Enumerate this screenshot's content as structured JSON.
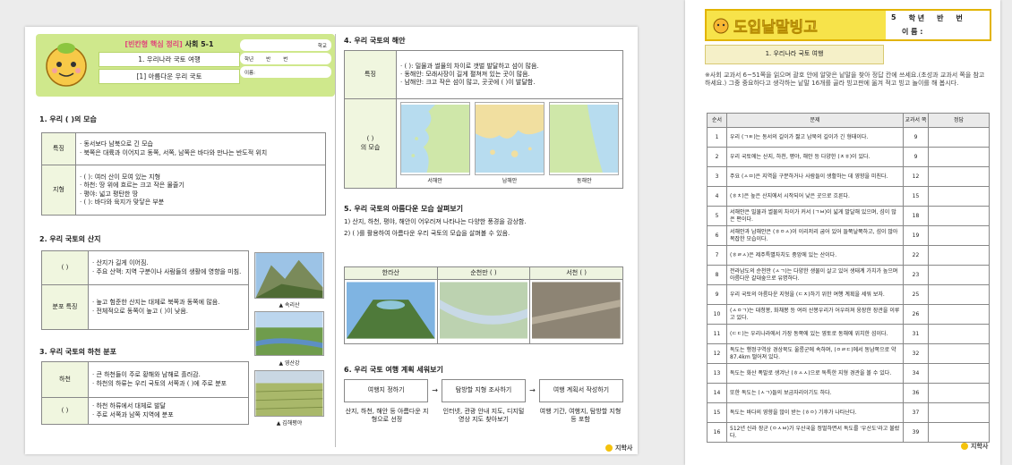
{
  "p1": {
    "header": {
      "badge": "[빈칸형 핵심 정리]",
      "subject": "사회 5-1",
      "unit": "1. 우리나라 국토 여행",
      "lesson": "[1] 아름다운 우리 국토",
      "school": "학교",
      "grade": "학년",
      "class": "반",
      "number": "번",
      "name": "이름:"
    },
    "s1": {
      "title": "1. 우리 (             )의 모습",
      "rows": [
        {
          "label": "특징",
          "lines": [
            "· 동서보다 남북으로 긴 모습",
            "· 북쪽은 대륙과 이어지고 동쪽, 서쪽, 남쪽은 바다와 만나는 반도적 위치"
          ]
        },
        {
          "label": "지형",
          "lines": [
            "· (             ): 여러 산이 모여 있는 지형",
            "· 하천: 땅 위에 흐르는 크고 작은 물줄기",
            "· 평야: 넓고 평탄한 땅",
            "· (             ): 바다와 육지가 맞닿은 부분"
          ]
        }
      ]
    },
    "s2": {
      "title": "2. 우리 국토의 산지",
      "rows": [
        {
          "label": "(           )",
          "lines": [
            "· 산지가 길게 이어짐.",
            "· 주요 산맥: 지역 구분이나 사람들의 생활에 영향을 미침."
          ]
        },
        {
          "label": "분포 특징",
          "lines": [
            "· 높고 험준한 산지는 대체로 북쪽과 동쪽에 많음.",
            "· 전체적으로 동쪽이 높고 (         )이 낮음."
          ]
        }
      ]
    },
    "s3": {
      "title": "3. 우리 국토의 하천 분포",
      "rows": [
        {
          "label": "하천",
          "lines": [
            "· 큰 하천들이 주로 황해와 남해로 흘러감.",
            "· 하천의 하류는 우리 국토의 서쪽과 (           )에 주로 분포"
          ]
        },
        {
          "label": "(           )",
          "lines": [
            "· 하천 하류에서 대체로 발달",
            "· 주로 서쪽과 남쪽 지역에 분포"
          ]
        }
      ]
    },
    "photos": {
      "cap1": "▲ 속리산",
      "cap2": "▲ 영산강",
      "cap3": "▲ 김해평야"
    },
    "s4": {
      "title": "4. 우리 국토의 해안",
      "feat_label": "특징",
      "feat_lines": [
        "· (             ): 밀물과 썰물의 차이로 갯벌 발달하고 섬이 많음.",
        "· 동해안: 모래사장이 길게 펼쳐져 있는 곳이 많음.",
        "· 남해안: 크고 작은 섬이 많고, 곳곳에 (         )이 발달함."
      ],
      "shape_label1": "(           )",
      "shape_label2": "의 모습",
      "maps": [
        "서해안",
        "남해안",
        "동해안"
      ]
    },
    "s5": {
      "title": "5. 우리 국토의 아름다운 모습 살펴보기",
      "line1": "1) 산지, 하천, 평야, 해안이 어우러져 나타나는 다양한 풍경을 감상함.",
      "line2": "2) (                        )를 활용하여 아름다운 우리 국토의 모습을 살펴볼 수 있음.",
      "photos": [
        "한라산",
        "순천만 (          )",
        "서천 (          )"
      ]
    },
    "s6": {
      "title": "6. 우리 국토 여행 계획 세워보기",
      "steps": [
        "여행지 정하기",
        "탐방할 지형 조사하기",
        "여행 계획서 작성하기"
      ],
      "arrow": "→",
      "details": [
        "산지, 하천, 해안 등 아름다운 지형으로 선정",
        "인터넷, 관광 안내 지도, 디지털 영상 지도 찾아보기",
        "여행 기간, 여행지, 탐방할 지형 등 포함"
      ]
    },
    "logo": "지학사"
  },
  "p2": {
    "title": "도입낱말빙고",
    "grade_no": "5",
    "grade": "학 년",
    "class": "반",
    "num": "번",
    "name": "이 름 :",
    "unit": "1. 우리나라 국토 여행",
    "intro": "※사회 교과서 6~51쪽을 읽으며 괄호 안에 알맞은 낱말을 찾아 정답 칸에 쓰세요.(초성과 교과서 쪽을 참고하세요.) 그중 중요하다고 생각하는 낱말 16개를 골라 빙고판에 옮겨 적고 빙고 놀이를 해 봅시다.",
    "cols": [
      "순서",
      "문제",
      "교과서 쪽",
      "정답"
    ],
    "rows": [
      [
        "1",
        "우리 (ㄱㅌ)는 동서의 길이가 짧고 남북의 길이가 긴 형태이다.",
        "9"
      ],
      [
        "2",
        "우리 국토에는 산지, 하천, 평야, 해안 등 다양한 (ㅈㅎ)이 있다.",
        "9"
      ],
      [
        "3",
        "주요 (ㅅㅁ)은 지역을 구분하거나 사람들이 생활하는 데 영향을 미친다.",
        "12"
      ],
      [
        "4",
        "(ㅎㅊ)은 높은 산지에서 시작되어 낮은 곳으로 흐른다.",
        "15"
      ],
      [
        "5",
        "서해안은 밀물과 썰물의 차이가 커서 (ㄱㅂ)이 넓게 발달해 있으며, 섬이 많은 편이다.",
        "18"
      ],
      [
        "6",
        "서해안과 남해안은 (ㅎㅇㅅ)이 이리저리 굽어 있어 들쭉날쭉하고, 섬이 많아 복잡한 모습이다.",
        "19"
      ],
      [
        "7",
        "(ㅎㄹㅅ)은 제주특별자치도 중앙에 있는 산이다.",
        "22"
      ],
      [
        "8",
        "전라남도의 순천만 (ㅅㄱ)는 다양한 생물이 살고 있어 생태계 가치가 높으며 아름다운 갈대숲으로 유명하다.",
        "23"
      ],
      [
        "9",
        "우리 국토의 아름다운 지형을 (ㄷㅈ)하기 위한 여행 계획을 세워 보자.",
        "25"
      ],
      [
        "10",
        "(ㅅㅇㄱ)는 대청봉, 화채봉 등 여러 산봉우리가 어우러져 웅장한 장관을 이루고 있다.",
        "26"
      ],
      [
        "11",
        "(ㄷㄷ)는 우리나라에서 가장 동쪽에 있는 영토로 동해에 위치한 섬이다.",
        "31"
      ],
      [
        "12",
        "독도는 행정구역상 경상북도 울릉군에 속하며, (ㅇㄹㄷ)에서 동남쪽으로 약 87.4km 떨어져 있다.",
        "32"
      ],
      [
        "13",
        "독도는 화산 폭발로 생겨난 (ㅎㅅㅅ)으로 독특한 지형 경관을 볼 수 있다.",
        "34"
      ],
      [
        "14",
        "또한 독도는 (ㅅㄱ)들의 보금자리이기도 하다.",
        "36"
      ],
      [
        "15",
        "독도는 바다의 영향을 많이 받는 (ㅎㅇ) 기후가 나타난다.",
        "37"
      ],
      [
        "16",
        "512년 신라 장군 (ㅇㅅㅂ)가 우산국을 정벌하면서 독도를 '우산도'라고 불렀다.",
        "39"
      ]
    ],
    "logo": "지학사"
  }
}
